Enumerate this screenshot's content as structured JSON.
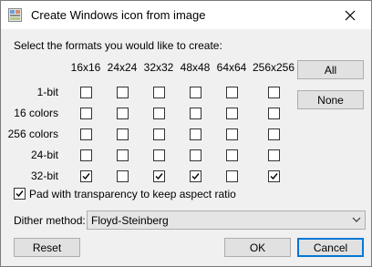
{
  "window": {
    "title": "Create Windows icon from image",
    "close_glyph": "✕"
  },
  "intro_text": "Select the formats you would like to create:",
  "columns": [
    "16x16",
    "24x24",
    "32x32",
    "48x48",
    "64x64",
    "256x256"
  ],
  "rows": [
    {
      "label": "1-bit",
      "checked": [
        false,
        false,
        false,
        false,
        false,
        false
      ]
    },
    {
      "label": "16 colors",
      "checked": [
        false,
        false,
        false,
        false,
        false,
        false
      ]
    },
    {
      "label": "256 colors",
      "checked": [
        false,
        false,
        false,
        false,
        false,
        false
      ]
    },
    {
      "label": "24-bit",
      "checked": [
        false,
        false,
        false,
        false,
        false,
        false
      ]
    },
    {
      "label": "32-bit",
      "checked": [
        true,
        false,
        true,
        true,
        false,
        true
      ]
    }
  ],
  "buttons": {
    "all": "All",
    "none": "None",
    "reset": "Reset",
    "ok": "OK",
    "cancel": "Cancel"
  },
  "pad_option": {
    "label": "Pad with transparency to keep aspect ratio",
    "checked": true
  },
  "dither": {
    "label": "Dither method:",
    "value": "Floyd-Steinberg"
  },
  "colors": {
    "accent": "#0078d7",
    "checkmark": "#000000"
  },
  "icons": {
    "title": "app-image-icon",
    "close": "close-icon",
    "dropdown": "chevron-down-icon",
    "check": "checkmark-icon"
  }
}
